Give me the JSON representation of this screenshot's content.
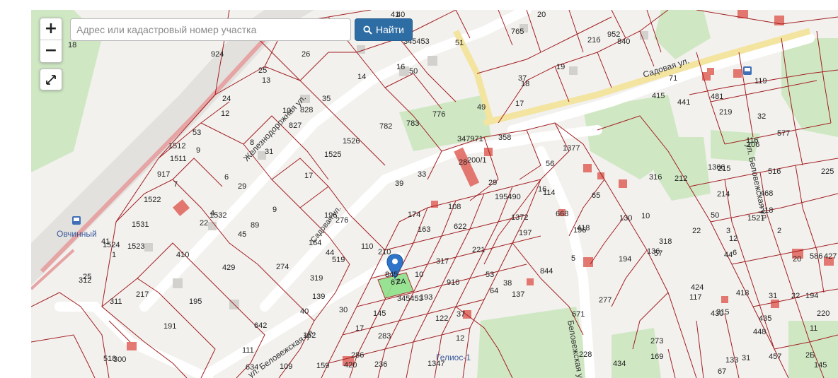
{
  "controls": {
    "zoom_in": "+",
    "zoom_out": "−",
    "search_placeholder": "Адрес или кадастровый номер участка",
    "search_button": "Найти"
  },
  "streets": {
    "zheleznodorozhnaya": "Железнодорожная ул.",
    "sadovaya_upper": "Садовая ул.",
    "sadovaya_lower": "Садовая ул.",
    "belovezhskaya_lower": "ул. Беловежская ул.",
    "belovezhskaya_right": "Беловежская ул.",
    "belovezhskaya_far": "ул. Беловежская ул."
  },
  "places": {
    "ovchinny": "Овчинный",
    "gelios": "Гелиос-1"
  },
  "parcel_labels": [
    "41",
    "40",
    "20",
    "765",
    "18",
    "51",
    "21б",
    "952",
    "840",
    "345453",
    "924",
    "26",
    "13",
    "16",
    "50",
    "19",
    "25",
    "14",
    "37",
    "24",
    "35",
    "12",
    "49",
    "17",
    "18",
    "441",
    "71",
    "481",
    "53",
    "828",
    "10",
    "827",
    "415",
    "119",
    "219",
    "32",
    "577",
    "1512",
    "1511",
    "9",
    "8",
    "31",
    "782",
    "783",
    "776",
    "1526",
    "347971",
    "358",
    "1377",
    "106",
    "116",
    "917",
    "7",
    "6",
    "29",
    "1525",
    "28",
    "200/1",
    "56",
    "316",
    "212",
    "1366",
    "215",
    "516",
    "225",
    "17",
    "39",
    "33",
    "29",
    "195490",
    "16",
    "114",
    "65",
    "214",
    "468",
    "1522",
    "4",
    "1532",
    "9",
    "196",
    "174",
    "108",
    "1372",
    "668",
    "418",
    "130",
    "10",
    "50",
    "218",
    "1521",
    "1531",
    "22",
    "1524",
    "1523",
    "89",
    "45",
    "276",
    "163",
    "622",
    "197",
    "196",
    "136",
    "318",
    "22",
    "3",
    "2",
    "12",
    "586",
    "41",
    "1",
    "410",
    "164",
    "110",
    "210",
    "44",
    "519",
    "317",
    "221",
    "844",
    "6",
    "5",
    "194",
    "57",
    "44",
    "20",
    "427",
    "25",
    "429",
    "274",
    "217",
    "195",
    "319",
    "845",
    "2А",
    "10",
    "910",
    "53",
    "38",
    "424",
    "418",
    "31",
    "22",
    "312",
    "311",
    "139",
    "345453",
    "193",
    "64",
    "137",
    "277",
    "117",
    "430",
    "315",
    "435",
    "194",
    "220",
    "40",
    "30",
    "145",
    "122",
    "37",
    "671",
    "642",
    "162",
    "17",
    "283",
    "12",
    "273",
    "448",
    "11",
    "191",
    "111",
    "228",
    "169",
    "133",
    "31",
    "457",
    "2Б",
    "518",
    "300",
    "634",
    "109",
    "159",
    "286",
    "420",
    "236",
    "1347",
    "434",
    "67",
    "145"
  ],
  "selected_parcel": {
    "number": "67"
  }
}
